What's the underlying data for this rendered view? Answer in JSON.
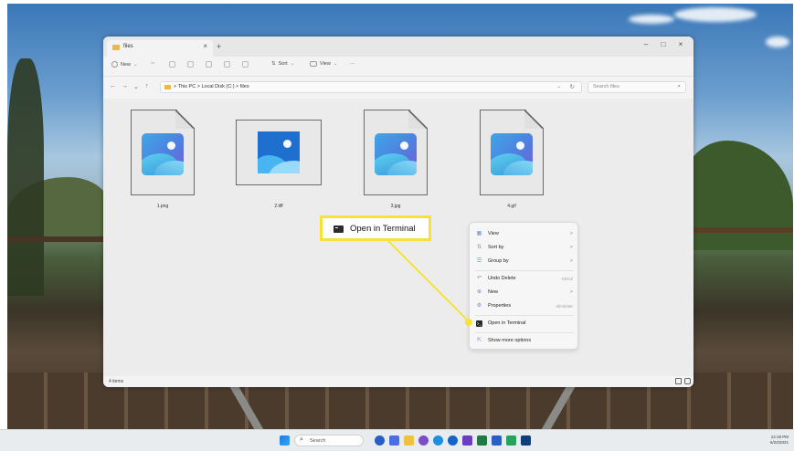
{
  "window": {
    "tab_title": "files",
    "tab_close": "×",
    "tab_add": "+",
    "minimize": "–",
    "maximize": "□",
    "close": "×"
  },
  "toolbar": {
    "new_label": "New",
    "sort_label": "Sort",
    "view_label": "View",
    "more_label": "···"
  },
  "address": {
    "path": "> This PC > Local Disk (C:) > files",
    "search_placeholder": "Search files"
  },
  "files": [
    {
      "name": "1.png",
      "icon": "image-file-icon"
    },
    {
      "name": "2.tiff",
      "icon": "image-thumbnail-icon"
    },
    {
      "name": "3.jpg",
      "icon": "image-file-icon"
    },
    {
      "name": "4.gif",
      "icon": "image-file-icon"
    }
  ],
  "context_menu": {
    "items": [
      {
        "label": "View",
        "icon": "grid-icon",
        "arrow": ">"
      },
      {
        "label": "Sort by",
        "icon": "sort-icon",
        "arrow": ">"
      },
      {
        "label": "Group by",
        "icon": "group-icon",
        "arrow": ">"
      },
      {
        "label": "Undo Delete",
        "icon": "undo-icon",
        "shortcut": "Ctrl+Z"
      },
      {
        "label": "New",
        "icon": "plus-circle-icon",
        "arrow": ">"
      },
      {
        "label": "Properties",
        "icon": "wrench-icon",
        "shortcut": "Alt+Enter"
      },
      {
        "label": "Open in Terminal",
        "icon": "terminal-icon"
      },
      {
        "label": "Show more options",
        "icon": "share-icon"
      }
    ]
  },
  "status": {
    "item_count": "4 items"
  },
  "callout": {
    "label": "Open in Terminal",
    "color": "#f5e33a"
  },
  "taskbar": {
    "search_label": "Search",
    "clock_time": "12:19 PM",
    "clock_date": "6/22/2021"
  }
}
